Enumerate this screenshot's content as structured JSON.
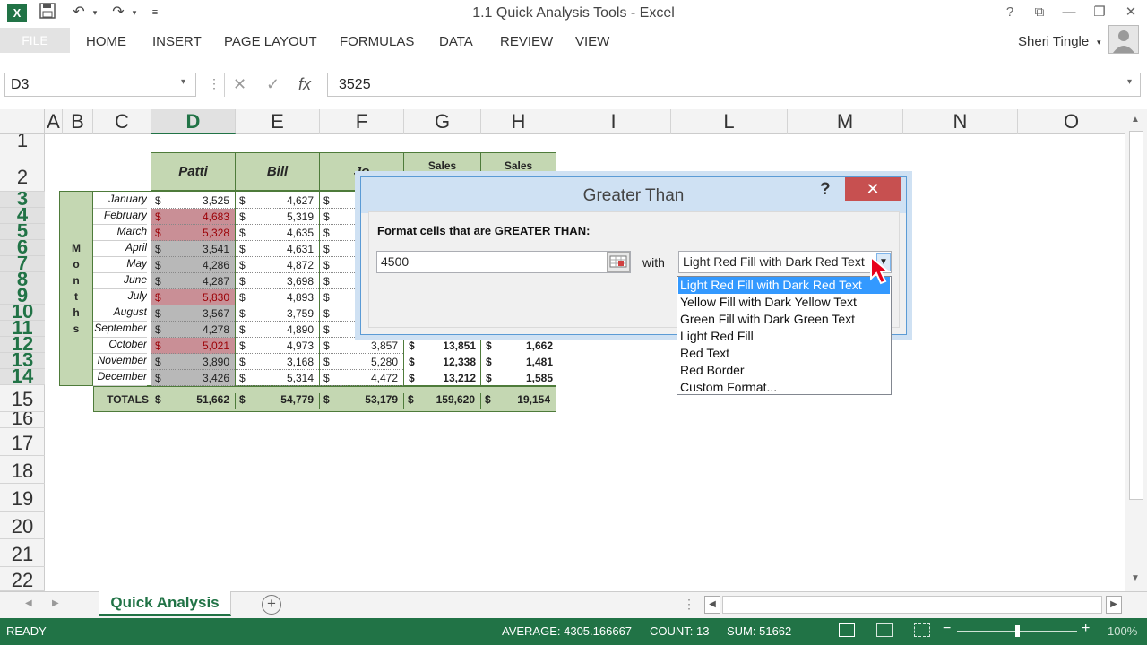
{
  "window": {
    "title": "1.1 Quick Analysis Tools - Excel",
    "user": "Sheri Tingle",
    "help_glyph": "?",
    "restore_glyph": "⧉",
    "min_glyph": "—",
    "max_glyph": "❐",
    "close_glyph": "✕"
  },
  "ribbon": {
    "file": "FILE",
    "tabs": [
      "HOME",
      "INSERT",
      "PAGE LAYOUT",
      "FORMULAS",
      "DATA",
      "REVIEW",
      "VIEW"
    ]
  },
  "formula_bar": {
    "name_box": "D3",
    "value": "3525",
    "cancel_glyph": "✕",
    "enter_glyph": "✓",
    "fx_glyph": "fx"
  },
  "columns": [
    "A",
    "B",
    "C",
    "D",
    "E",
    "F",
    "G",
    "H",
    "I",
    "L",
    "M",
    "N",
    "O"
  ],
  "rows": [
    "1",
    "2",
    "3",
    "4",
    "5",
    "6",
    "7",
    "8",
    "9",
    "10",
    "11",
    "12",
    "13",
    "14",
    "15",
    "16",
    "17",
    "18",
    "19",
    "20",
    "21",
    "22"
  ],
  "sheet": {
    "headers": {
      "patti": "Patti",
      "bill": "Bill",
      "jo": "Jo",
      "sales_g": "Sales",
      "sales_h": "Sales"
    },
    "months_label": [
      "M",
      "o",
      "n",
      "t",
      "h",
      "s"
    ],
    "months": [
      "January",
      "February",
      "March",
      "April",
      "May",
      "June",
      "July",
      "August",
      "September",
      "October",
      "November",
      "December"
    ],
    "patti": [
      "3,525",
      "4,683",
      "5,328",
      "3,541",
      "4,286",
      "4,287",
      "5,830",
      "3,567",
      "4,278",
      "5,021",
      "3,890",
      "3,426"
    ],
    "patti_highlight": [
      false,
      true,
      true,
      false,
      false,
      false,
      true,
      false,
      false,
      true,
      false,
      false
    ],
    "bill": [
      "4,627",
      "5,319",
      "4,635",
      "4,631",
      "4,872",
      "3,698",
      "4,893",
      "3,759",
      "4,890",
      "4,973",
      "3,168",
      "5,314"
    ],
    "jo_visible": [
      "3,857",
      "5,280",
      "4,472"
    ],
    "g_visible": [
      "13,851",
      "12,338",
      "13,212"
    ],
    "h_visible": [
      "1,662",
      "1,481",
      "1,585"
    ],
    "dollar": "$",
    "totals_label": "TOTALS",
    "totals": [
      "51,662",
      "54,779",
      "53,179",
      "159,620",
      "19,154"
    ]
  },
  "dialog": {
    "title": "Greater Than",
    "prompt": "Format cells that are GREATER THAN:",
    "input_value": "4500",
    "with_label": "with",
    "selected_format": "Light Red Fill with Dark Red Text",
    "options": [
      "Light Red Fill with Dark Red Text",
      "Yellow Fill with Dark Yellow Text",
      "Green Fill with Dark Green Text",
      "Light Red Fill",
      "Red Text",
      "Red Border",
      "Custom Format..."
    ]
  },
  "sheet_tab": {
    "name": "Quick Analysis",
    "add_glyph": "+"
  },
  "status_bar": {
    "mode": "READY",
    "average": "AVERAGE: 4305.166667",
    "count": "COUNT: 13",
    "sum": "SUM: 51662",
    "zoom": "100%"
  },
  "colors": {
    "accent": "#217346",
    "header_fill": "#c4d7b2",
    "highlight_text": "#9c0006",
    "highlight_fill": "#d9a0a6"
  }
}
